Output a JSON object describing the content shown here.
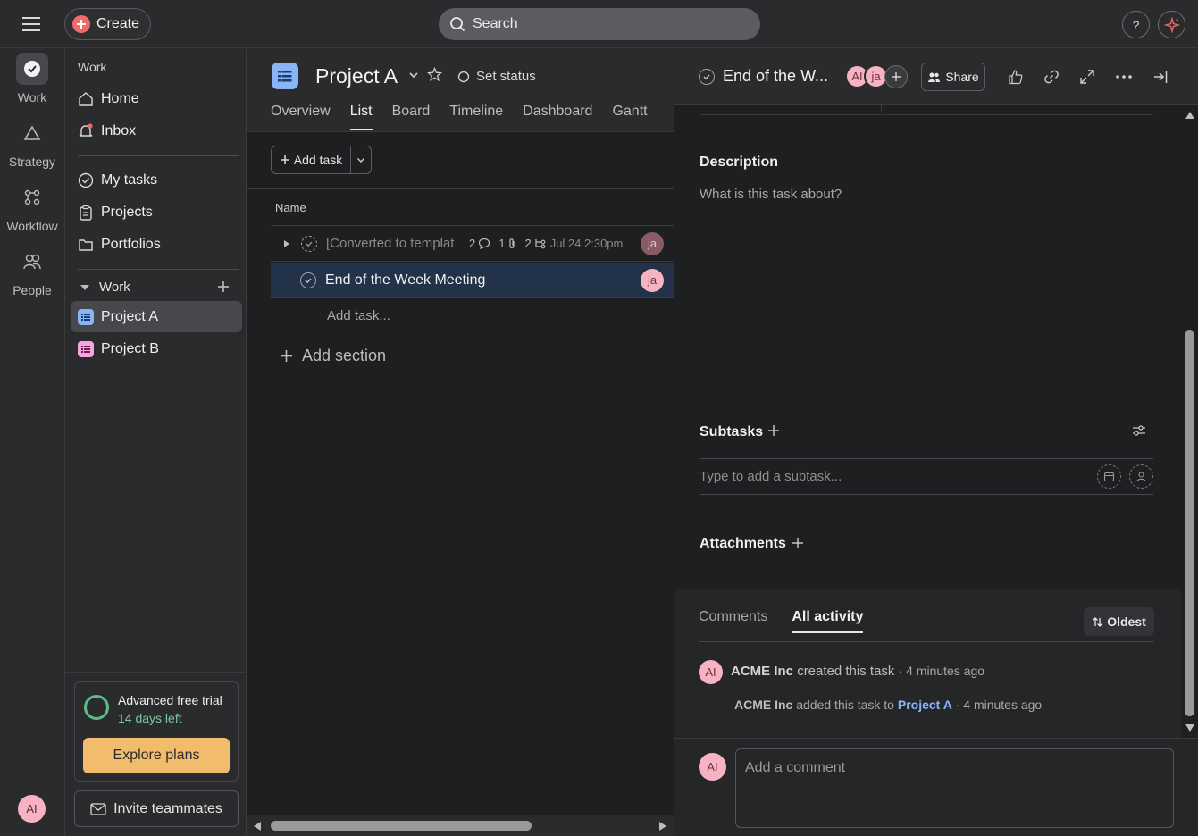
{
  "topbar": {
    "create_label": "Create",
    "search_placeholder": "Search",
    "help_label": "?"
  },
  "rail": {
    "items": [
      {
        "label": "Work"
      },
      {
        "label": "Strategy"
      },
      {
        "label": "Workflow"
      },
      {
        "label": "People"
      }
    ],
    "avatar_initials": "AI"
  },
  "sidebar": {
    "header": "Work",
    "nav": [
      {
        "label": "Home"
      },
      {
        "label": "Inbox"
      }
    ],
    "personal": [
      {
        "label": "My tasks"
      },
      {
        "label": "Projects"
      },
      {
        "label": "Portfolios"
      }
    ],
    "work_section": "Work",
    "projects": [
      {
        "label": "Project A",
        "color": "#8ab4f8"
      },
      {
        "label": "Project B",
        "color": "#f4a6e0"
      }
    ],
    "trial_title": "Advanced free trial",
    "trial_days": "14 days left",
    "explore_label": "Explore plans",
    "invite_label": "Invite teammates"
  },
  "project": {
    "title": "Project A",
    "set_status": "Set status",
    "tabs": [
      "Overview",
      "List",
      "Board",
      "Timeline",
      "Dashboard",
      "Gantt"
    ],
    "active_tab": "List",
    "add_task_label": "Add task",
    "column_name": "Name",
    "tasks": [
      {
        "name": "[Converted to templat",
        "comments": "2",
        "attachments": "1",
        "subtasks": "2",
        "due": "Jul 24 2:30pm",
        "assignee": "ja"
      },
      {
        "name": "End of the Week Meeting",
        "assignee": "ja"
      }
    ],
    "add_task_inline": "Add task...",
    "add_section": "Add section"
  },
  "detail": {
    "title": "End of the W...",
    "collaborators": [
      "AI",
      "ja"
    ],
    "share_label": "Share",
    "description_title": "Description",
    "description_placeholder": "What is this task about?",
    "subtasks_title": "Subtasks",
    "subtask_placeholder": "Type to add a subtask...",
    "attachments_title": "Attachments",
    "activity_tabs": [
      "Comments",
      "All activity"
    ],
    "oldest_label": "Oldest",
    "activity": {
      "actor": "ACME Inc",
      "created_text": "created this task",
      "created_time": "· 4 minutes ago",
      "added_actor": "ACME Inc",
      "added_text": "added this task to",
      "added_project": "Project A",
      "added_time": "· 4 minutes ago",
      "avatar": "AI"
    },
    "comment_placeholder": "Add a comment",
    "comment_avatar": "AI"
  },
  "colors": {
    "accent_red": "#f06a6a",
    "explore_button": "#f1bd6c",
    "selected_row": "#213249",
    "link_blue": "#8ab4f8"
  }
}
